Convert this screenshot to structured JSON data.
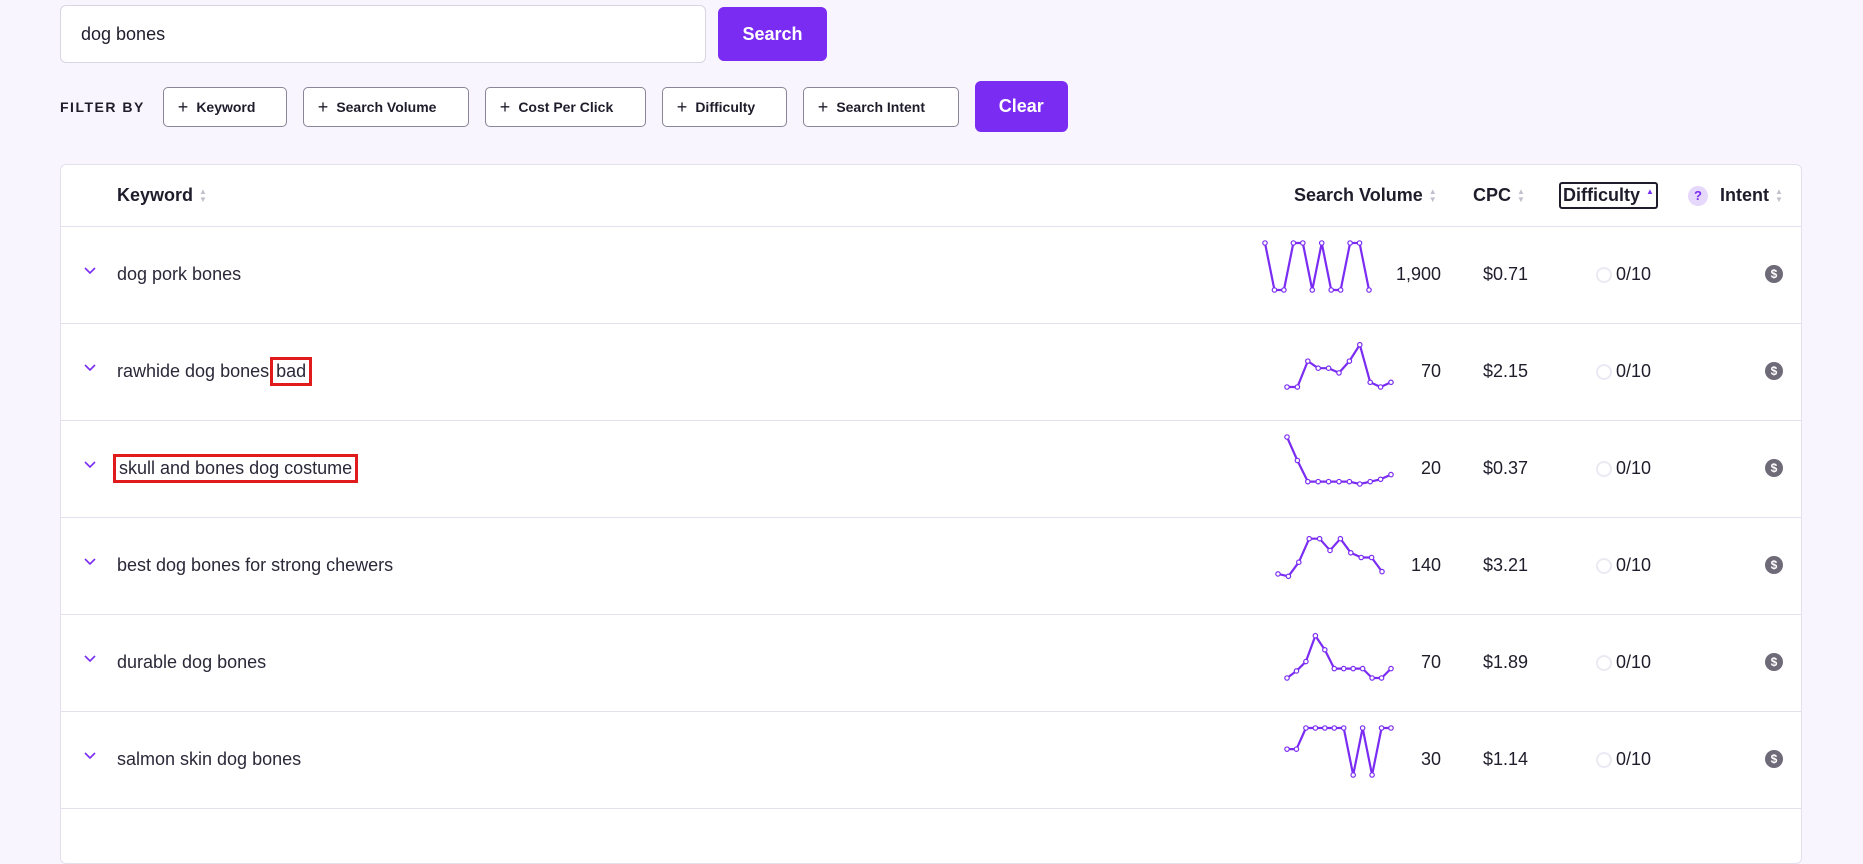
{
  "search": {
    "value": "dog bones",
    "button_label": "Search"
  },
  "filters": {
    "label": "FILTER BY",
    "chips": [
      "Keyword",
      "Search Volume",
      "Cost Per Click",
      "Difficulty",
      "Search Intent"
    ],
    "clear_label": "Clear"
  },
  "table": {
    "columns": {
      "keyword": "Keyword",
      "search_volume": "Search Volume",
      "cpc": "CPC",
      "difficulty": "Difficulty",
      "intent": "Intent"
    },
    "intent_help_icon": "?",
    "rows": [
      {
        "keyword": "dog pork bones",
        "keyword_suffix": "",
        "volume": "1,900",
        "cpc": "$0.71",
        "difficulty": "0/10",
        "intent_icon": "$",
        "trend": [
          1,
          0,
          0,
          1,
          1,
          0,
          1,
          0,
          0,
          1,
          1,
          0
        ]
      },
      {
        "keyword": "rawhide dog bones",
        "keyword_suffix": "bad",
        "volume": "70",
        "cpc": "$2.15",
        "difficulty": "0/10",
        "intent_icon": "$",
        "trend": [
          0,
          0,
          0.55,
          0.4,
          0.4,
          0.3,
          0.55,
          0.9,
          0.1,
          0,
          0.1
        ]
      },
      {
        "keyword": "skull and bones dog costume",
        "keyword_suffix": "",
        "volume": "20",
        "cpc": "$0.37",
        "difficulty": "0/10",
        "intent_icon": "$",
        "trend": [
          1,
          0.5,
          0.05,
          0.05,
          0.05,
          0.05,
          0.05,
          0,
          0.05,
          0.1,
          0.2
        ]
      },
      {
        "keyword": "best dog bones for strong chewers",
        "keyword_suffix": "",
        "volume": "140",
        "cpc": "$3.21",
        "difficulty": "0/10",
        "intent_icon": "$",
        "trend": [
          0.15,
          0.1,
          0.4,
          0.9,
          0.9,
          0.65,
          0.9,
          0.6,
          0.5,
          0.5,
          0.2
        ]
      },
      {
        "keyword": "durable dog bones",
        "keyword_suffix": "",
        "volume": "70",
        "cpc": "$1.89",
        "difficulty": "0/10",
        "intent_icon": "$",
        "trend": [
          0,
          0.15,
          0.35,
          0.9,
          0.6,
          0.2,
          0.2,
          0.2,
          0.2,
          0,
          0,
          0.2
        ]
      },
      {
        "keyword": "salmon skin dog bones",
        "keyword_suffix": "",
        "volume": "30",
        "cpc": "$1.14",
        "difficulty": "0/10",
        "intent_icon": "$",
        "trend": [
          0.55,
          0.55,
          1,
          1,
          1,
          1,
          1,
          0,
          1,
          0,
          1,
          1
        ]
      }
    ]
  },
  "colors": {
    "accent": "#7b2cf2",
    "highlight_box": "#e01b1b"
  }
}
